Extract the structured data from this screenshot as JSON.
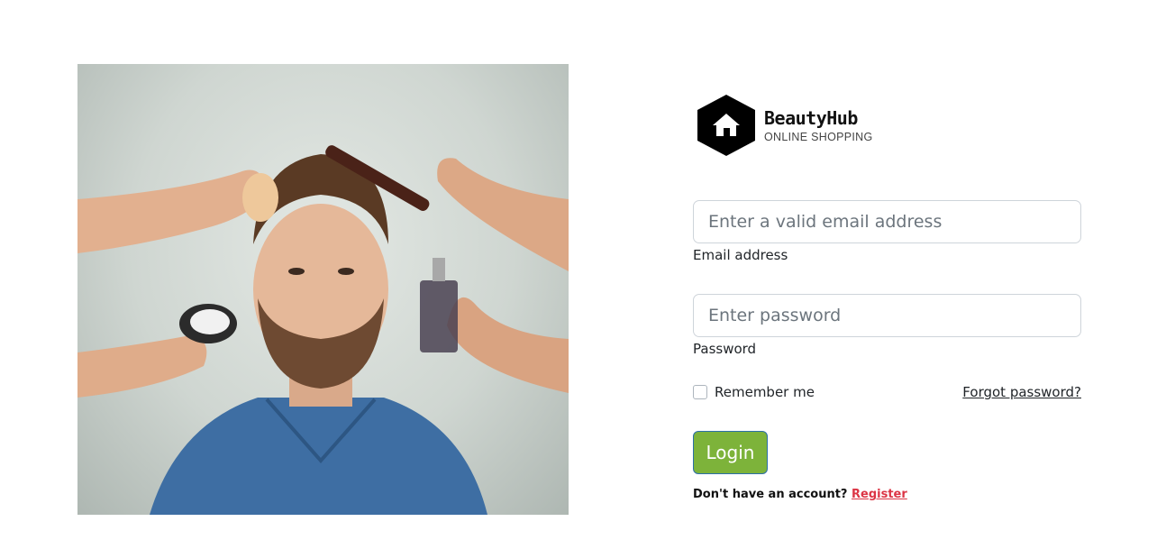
{
  "hero": {
    "image": "man-grooming-photo"
  },
  "brand": {
    "name": "BeautyHub",
    "tagline": "ONLINE SHOPPING",
    "icon": "house-hexagon-icon"
  },
  "form": {
    "email": {
      "placeholder": "Enter a valid email address",
      "value": "",
      "label": "Email address"
    },
    "password": {
      "placeholder": "Enter password",
      "value": "",
      "label": "Password"
    },
    "remember": {
      "label": "Remember me",
      "checked": false
    },
    "forgot_label": "Forgot password?",
    "login_label": "Login",
    "signup_text": "Don't have an account?",
    "register_label": "Register"
  },
  "colors": {
    "login_button": "#7db33a",
    "register_link": "#dc3545"
  }
}
